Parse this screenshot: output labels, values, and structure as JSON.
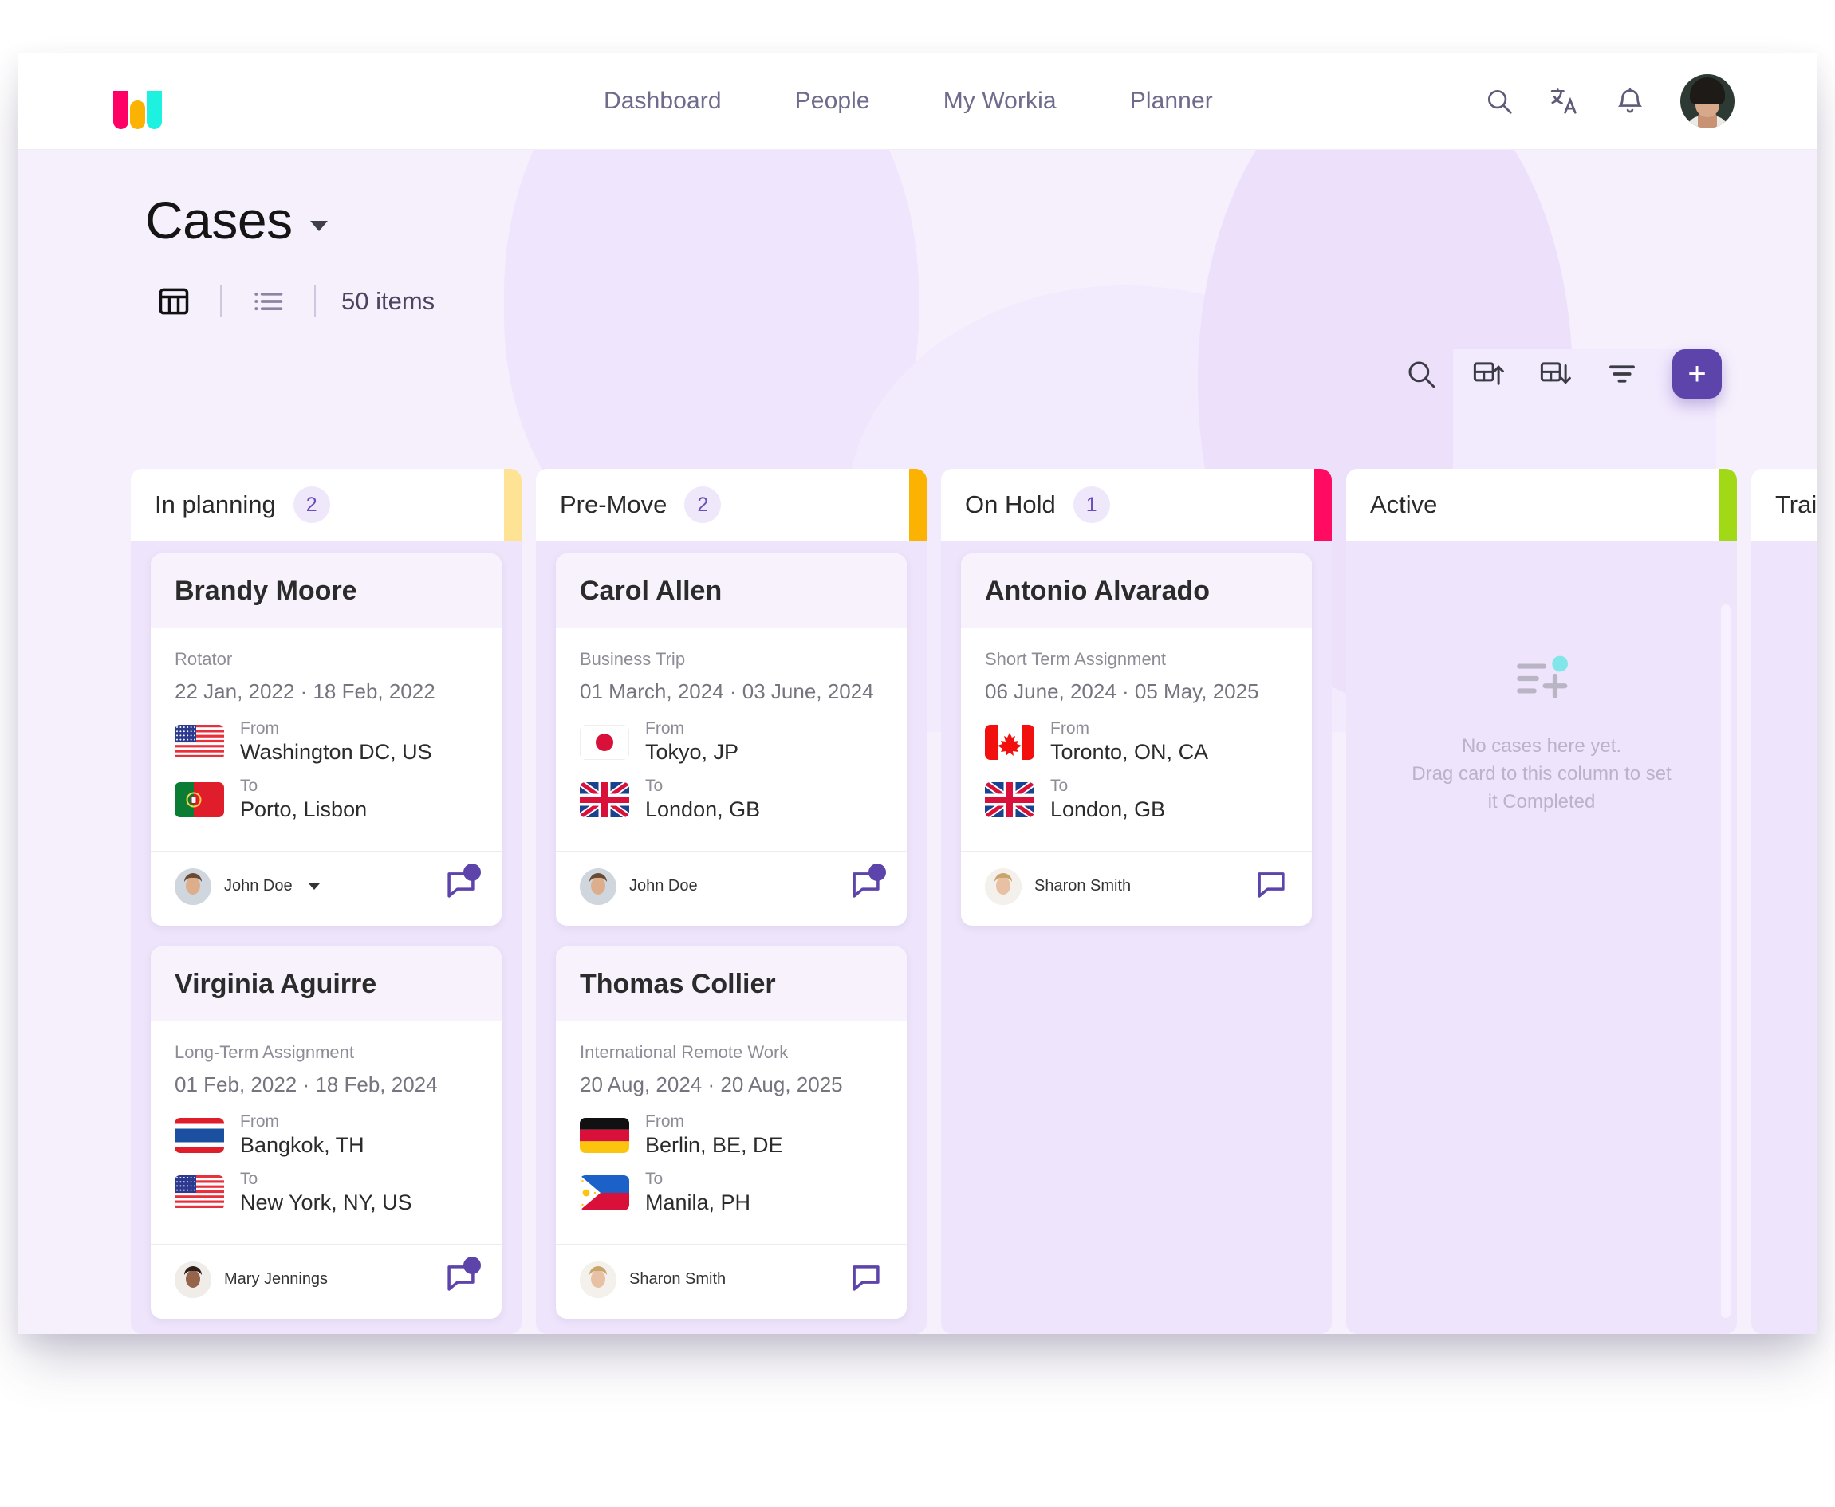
{
  "nav": {
    "logo_name": "workia-logo",
    "links": [
      "Dashboard",
      "People",
      "My Workia",
      "Planner"
    ],
    "icons": [
      "search-icon",
      "translate-icon",
      "bell-icon",
      "avatar"
    ]
  },
  "header": {
    "title": "Cases",
    "item_count": "50 items",
    "view_board": "board-view-icon",
    "view_list": "list-view-icon",
    "tools": [
      "search-icon",
      "export-icon",
      "import-icon",
      "filter-icon"
    ],
    "add_label": "+"
  },
  "board": {
    "columns": [
      {
        "name": "In planning",
        "count": "2",
        "accent": "#FFE394",
        "cards": [
          {
            "name": "Brandy Moore",
            "type": "Rotator",
            "dates": "22 Jan, 2022 · 18 Feb, 2022",
            "from_label": "From",
            "from_value": "Washington DC, US",
            "from_flag": "flag-us",
            "to_label": "To",
            "to_value": "Porto, Lisbon",
            "to_flag": "flag-pt",
            "assignee": "John Doe",
            "has_caret": true,
            "has_comment_badge": true
          },
          {
            "name": "Virginia Aguirre",
            "type": "Long-Term Assignment",
            "dates": "01 Feb, 2022 · 18 Feb, 2024",
            "from_label": "From",
            "from_value": "Bangkok, TH",
            "from_flag": "flag-th",
            "to_label": "To",
            "to_value": "New York, NY, US",
            "to_flag": "flag-us",
            "assignee": "Mary Jennings",
            "has_caret": false,
            "has_comment_badge": true
          }
        ]
      },
      {
        "name": "Pre-Move",
        "count": "2",
        "accent": "#FBB200",
        "cards": [
          {
            "name": "Carol Allen",
            "type": "Business Trip",
            "dates": "01 March, 2024 · 03 June, 2024",
            "from_label": "From",
            "from_value": "Tokyo, JP",
            "from_flag": "flag-jp",
            "to_label": "To",
            "to_value": "London, GB",
            "to_flag": "flag-gb",
            "assignee": "John Doe",
            "has_caret": false,
            "has_comment_badge": true
          },
          {
            "name": "Thomas Collier",
            "type": "International Remote Work",
            "dates": "20 Aug, 2024 · 20 Aug, 2025",
            "from_label": "From",
            "from_value": "Berlin, BE, DE",
            "from_flag": "flag-de",
            "to_label": "To",
            "to_value": "Manila, PH",
            "to_flag": "flag-ph",
            "assignee": "Sharon Smith",
            "has_caret": false,
            "has_comment_badge": false
          }
        ]
      },
      {
        "name": "On Hold",
        "count": "1",
        "accent": "#FF0B62",
        "cards": [
          {
            "name": "Antonio Alvarado",
            "type": "Short Term Assignment",
            "dates": "06 June, 2024 · 05 May, 2025",
            "from_label": "From",
            "from_value": "Toronto, ON, CA",
            "from_flag": "flag-ca",
            "to_label": "To",
            "to_value": "London, GB",
            "to_flag": "flag-gb",
            "assignee": "Sharon Smith",
            "has_caret": false,
            "has_comment_badge": false
          }
        ]
      },
      {
        "name": "Active",
        "count": "",
        "accent": "#A2D916",
        "cards": [],
        "empty_line1": "No cases here yet.",
        "empty_line2": "Drag card to this column to set",
        "empty_line3": "it Completed",
        "empty_icon": "add-to-list-icon"
      },
      {
        "name": "Trailing",
        "count": "",
        "accent": "#EEE4FB",
        "cards": []
      }
    ]
  },
  "colors": {
    "accent_purple": "#5d44ab",
    "page_bg": "#f6f0fd",
    "column_bg": "#eee4fb",
    "badge_cyan": "#1DE8D6"
  }
}
